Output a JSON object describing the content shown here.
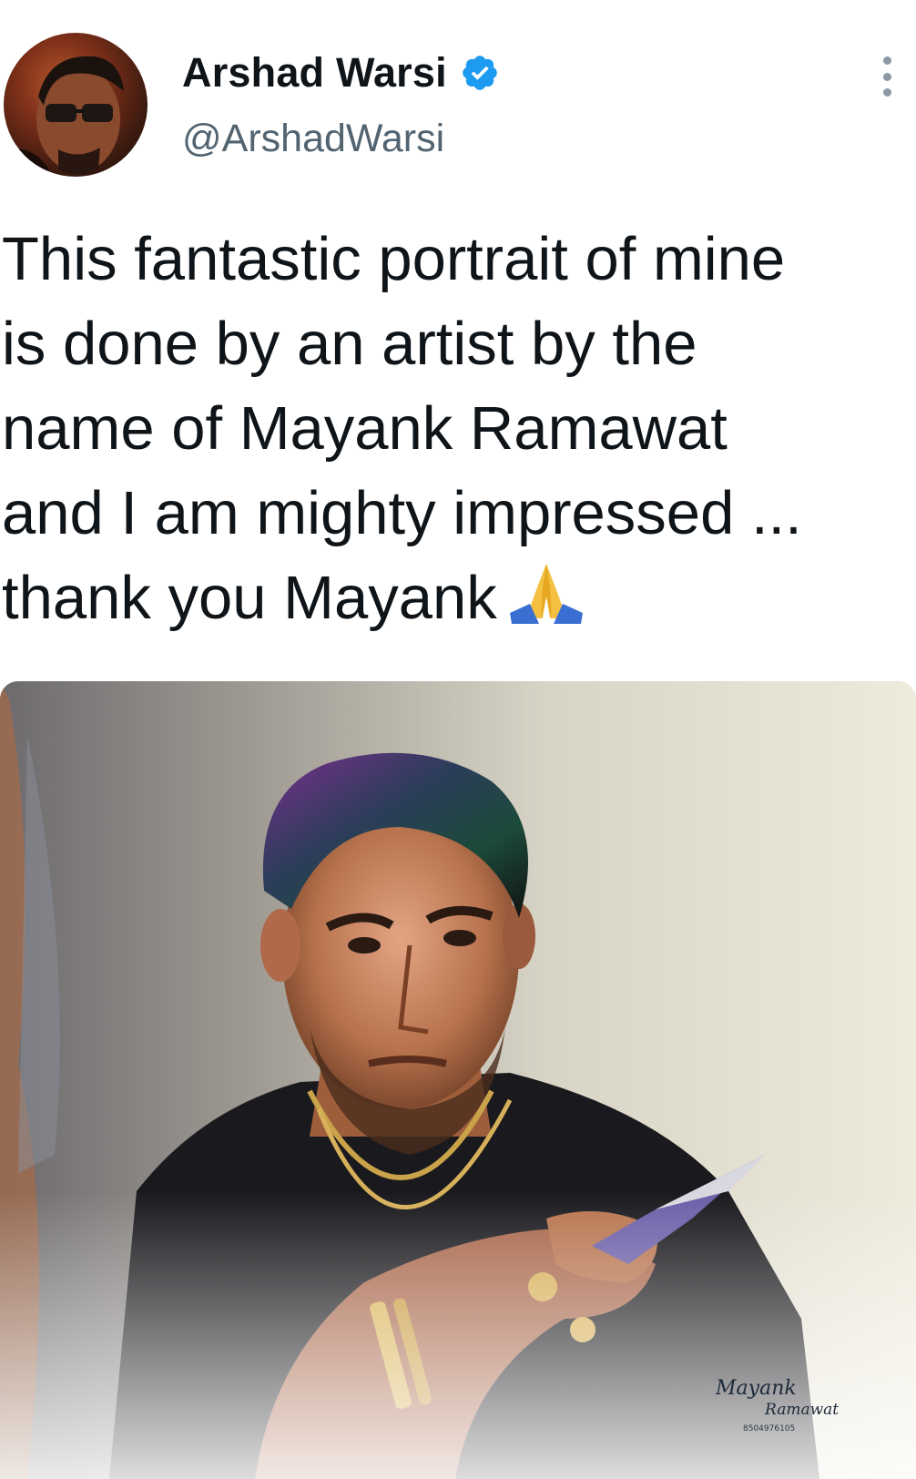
{
  "tweet": {
    "author": {
      "display_name": "Arshad Warsi",
      "handle": "@ArshadWarsi",
      "verified": true,
      "verified_icon": "verified-badge-icon"
    },
    "more_icon": "more-vertical-icon",
    "text": "This fantastic portrait of mine\nis done by an artist by the\nname of Mayank Ramawat\nand I am mighty impressed ...\nthank you Mayank",
    "emoji": "folded-hands-icon",
    "media": {
      "signature_line1": "Mayank",
      "signature_line2": "Ramawat",
      "signature_phone": "8504976105"
    }
  },
  "colors": {
    "text_primary": "#0f1419",
    "text_secondary": "#536471",
    "verified_blue": "#1d9bf0"
  }
}
